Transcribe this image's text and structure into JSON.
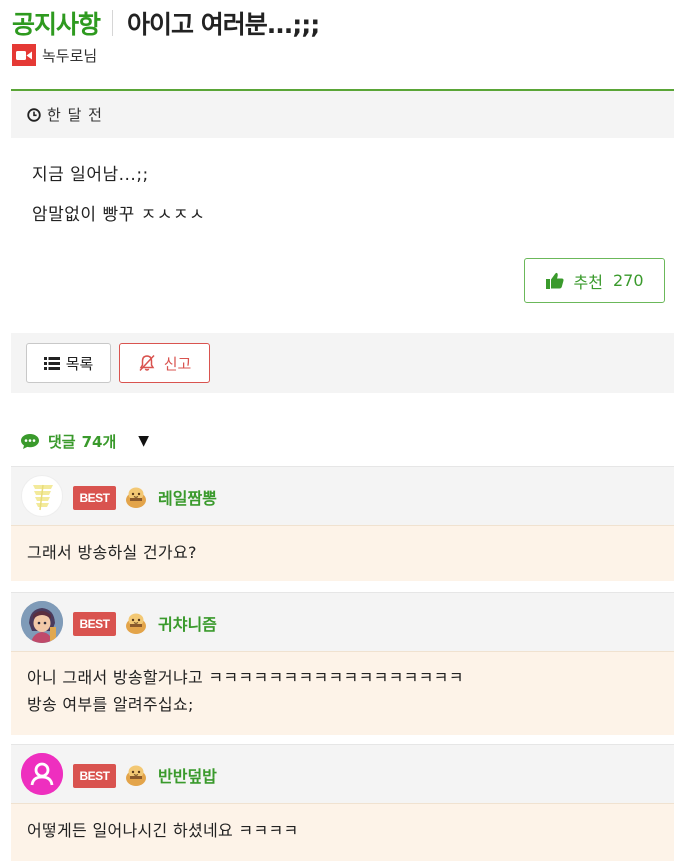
{
  "post": {
    "board_name": "공지사항",
    "title": "아이고 여러분...;;;",
    "author": "녹두로님",
    "time_ago": "한 달 전",
    "body_lines": [
      "지금 일어남...;;",
      "암말없이 빵꾸 ㅈㅅㅈㅅ"
    ],
    "recommend_label": "추천",
    "recommend_count": "270"
  },
  "actions": {
    "list_label": "목록",
    "report_label": "신고"
  },
  "comments_section": {
    "label": "댓글",
    "count": "74개",
    "toggle": "▼"
  },
  "comments": [
    {
      "badge": "BEST",
      "nickname": "레일짬뽕",
      "lines": [
        "그래서 방송하실 건가요?"
      ]
    },
    {
      "badge": "BEST",
      "nickname": "귀챠니즘",
      "lines": [
        "아니 그래서 방송할거냐고 ㅋㅋㅋㅋㅋㅋㅋㅋㅋㅋㅋㅋㅋㅋㅋㅋㅋ",
        "방송 여부를 알려주십쇼;"
      ]
    },
    {
      "badge": "BEST",
      "nickname": "반반덮밥",
      "lines": [
        "어떻게든 일어나시긴 하셨네요 ㅋㅋㅋㅋ"
      ]
    }
  ],
  "colors": {
    "accent_green": "#3a9a2c",
    "header_rule": "#5aa537",
    "report_red": "#d9534f",
    "best_badge": "#d9534f",
    "comment_bg": "#fdf3e8",
    "bar_bg": "#f4f4f4"
  },
  "icons": {
    "author": "video-camera-icon",
    "time": "clock-icon",
    "recommend": "thumbs-up-icon",
    "list": "list-icon",
    "report": "bell-slash-icon",
    "comments": "speech-bubble-icon",
    "level": "level-badge-icon"
  }
}
